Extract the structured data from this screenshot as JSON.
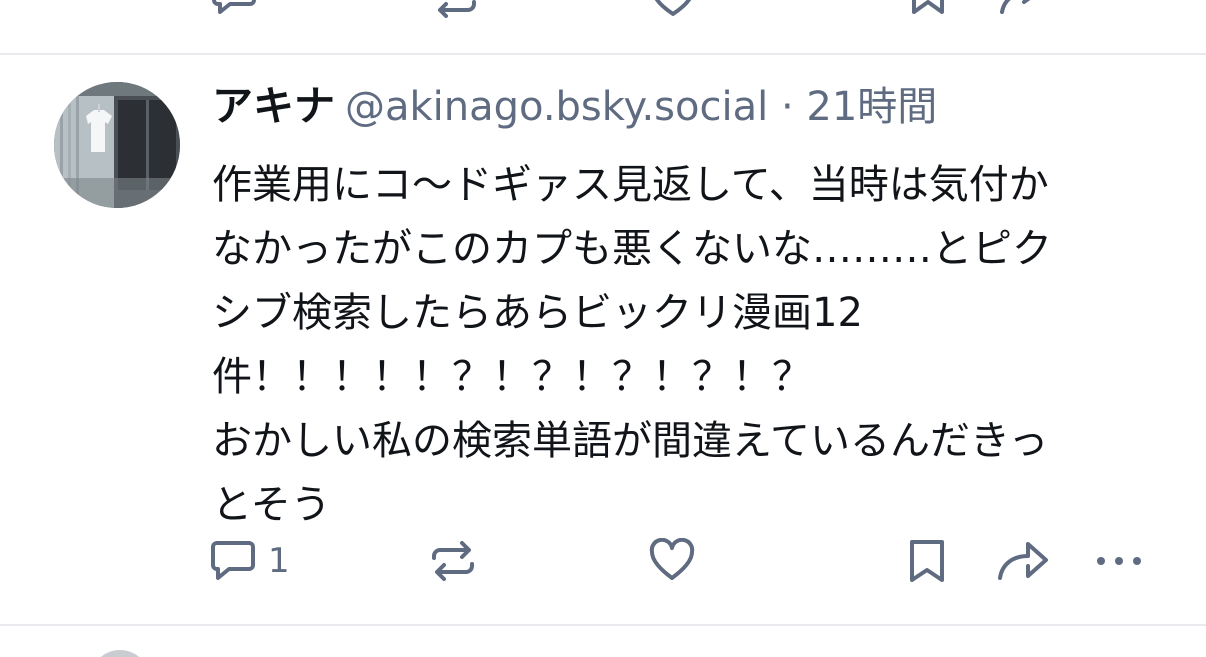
{
  "post": {
    "author": {
      "display_name": "アキナ",
      "handle": "@akinago.bsky.social",
      "avatar_icon": "avatar-photo"
    },
    "separator": " · ",
    "timestamp": "21時間",
    "text_lines": [
      "作業用にコ〜ドギァス見返して、当時は気付か",
      "なかったがこのカプも悪くないな………とピク",
      "シブ検索したらあらビックリ漫画12",
      "件！！！！！？！？！？！？！？",
      "おかしい私の検索単語が間違えているんだきっ",
      "とそう"
    ],
    "actions": {
      "reply_count": "1",
      "icons": [
        "reply-icon",
        "repost-icon",
        "like-icon",
        "bookmark-icon",
        "share-icon",
        "more-icon"
      ]
    }
  },
  "colors": {
    "text_primary": "#111418",
    "text_secondary": "#5f6b80",
    "icon": "#5f6b80",
    "divider": "#e8eaee"
  }
}
